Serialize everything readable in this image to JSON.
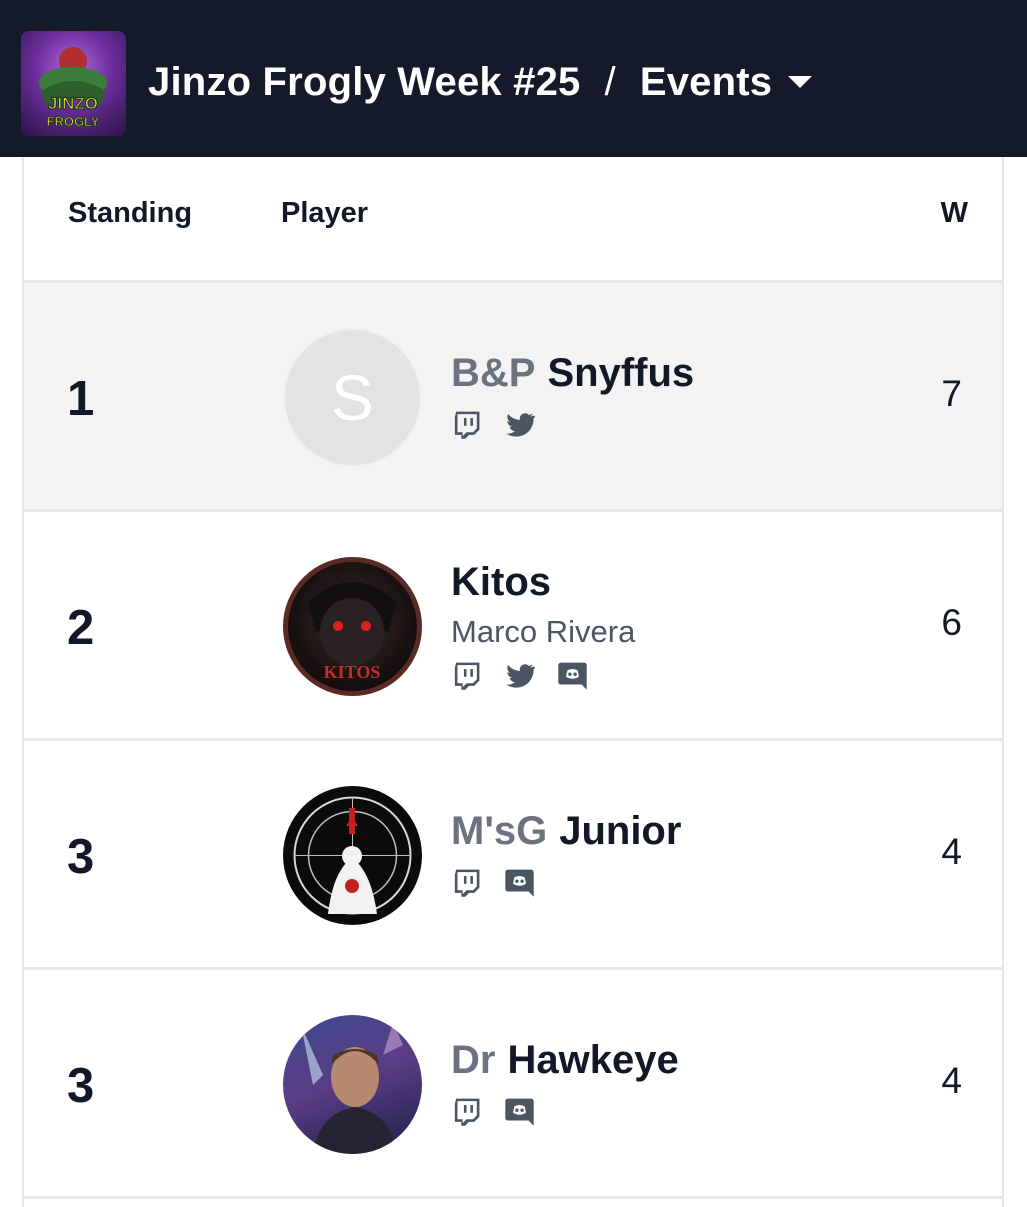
{
  "header": {
    "logo_text": [
      "JINZO",
      "FROGLY"
    ],
    "event_title": "Jinzo Frogly Week #25",
    "separator": "/",
    "section": "Events"
  },
  "table": {
    "columns": [
      "Standing",
      "Player",
      "W"
    ],
    "rows": [
      {
        "standing": "1",
        "prefix": "B&P",
        "name": "Snyffus",
        "real_name": "",
        "avatar": "initial",
        "avatar_initial": "S",
        "socials": [
          "twitch-icon",
          "twitter-icon"
        ],
        "wins": "7"
      },
      {
        "standing": "2",
        "prefix": "",
        "name": "Kitos",
        "real_name": "Marco Rivera",
        "avatar": "image",
        "avatar_text": "KITOS",
        "socials": [
          "twitch-icon",
          "twitter-icon",
          "discord-icon"
        ],
        "wins": "6"
      },
      {
        "standing": "3",
        "prefix": "M'sG",
        "name": "Junior",
        "real_name": "",
        "avatar": "image",
        "socials": [
          "twitch-icon",
          "discord-icon"
        ],
        "wins": "4"
      },
      {
        "standing": "3",
        "prefix": "Dr",
        "name": "Hawkeye",
        "real_name": "",
        "avatar": "image",
        "socials": [
          "twitch-icon",
          "discord-icon"
        ],
        "wins": "4"
      }
    ]
  },
  "colors": {
    "topbar": "#141a2a",
    "highlight_row": "#f3f3f3",
    "prefix": "#6b7280",
    "icon": "#4b5563"
  }
}
